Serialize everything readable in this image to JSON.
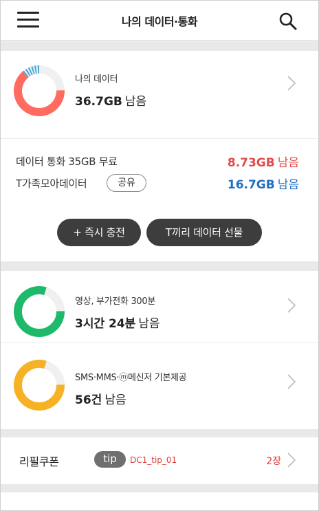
{
  "header": {
    "title": "나의 데이터·통화"
  },
  "data_card": {
    "label": "나의 데이터",
    "value": "36.7GB",
    "unit": "남음",
    "remaining_fraction": 0.84,
    "colors": {
      "main": "#ff6b5e",
      "secondary": "#4fa8d8",
      "track": "#f0f0f0"
    }
  },
  "data_rows": [
    {
      "label": "데이터 통화 35GB 무료",
      "amount": "8.73GB",
      "unit": "남음",
      "color": "#e04b4b"
    },
    {
      "label": "T가족모아데이터",
      "badge": "공유",
      "amount": "16.7GB",
      "unit": "남음",
      "color": "#1f6fc0"
    }
  ],
  "buttons": {
    "charge": "+ 즉시 충전",
    "gift": "T끼리 데이터 선물"
  },
  "voice_card": {
    "label": "영상, 부가전화 300분",
    "value": "3시간 24분",
    "unit": "남음",
    "remaining_fraction": 0.8,
    "color": "#1dba6c"
  },
  "sms_card": {
    "label": "SMS·MMS·ⓜ메신저 기본제공",
    "value": "56건",
    "unit": "남음",
    "remaining_fraction": 0.8,
    "color": "#f7b125"
  },
  "coupon": {
    "label": "리필쿠폰",
    "tip_badge": "tip",
    "tip_code": "DC1_tip_01",
    "count": "2장"
  }
}
